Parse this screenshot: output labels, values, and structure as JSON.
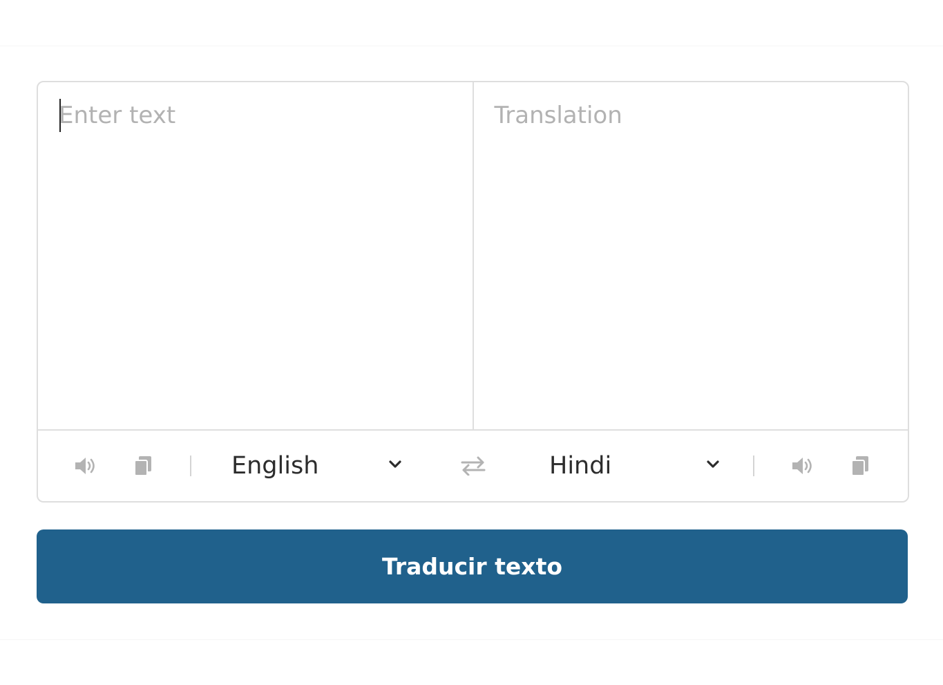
{
  "source": {
    "placeholder": "Enter text",
    "value": ""
  },
  "target": {
    "placeholder": "Translation",
    "value": ""
  },
  "toolbar": {
    "source_language": "English",
    "target_language": "Hindi",
    "icons": {
      "speaker": "speaker-icon",
      "copy": "copy-icon",
      "swap": "swap-icon",
      "chevron": "chevron-down-icon"
    },
    "icon_color": "#b3b3b3"
  },
  "translate_button": {
    "label": "Traducir texto",
    "color": "#20618c"
  }
}
